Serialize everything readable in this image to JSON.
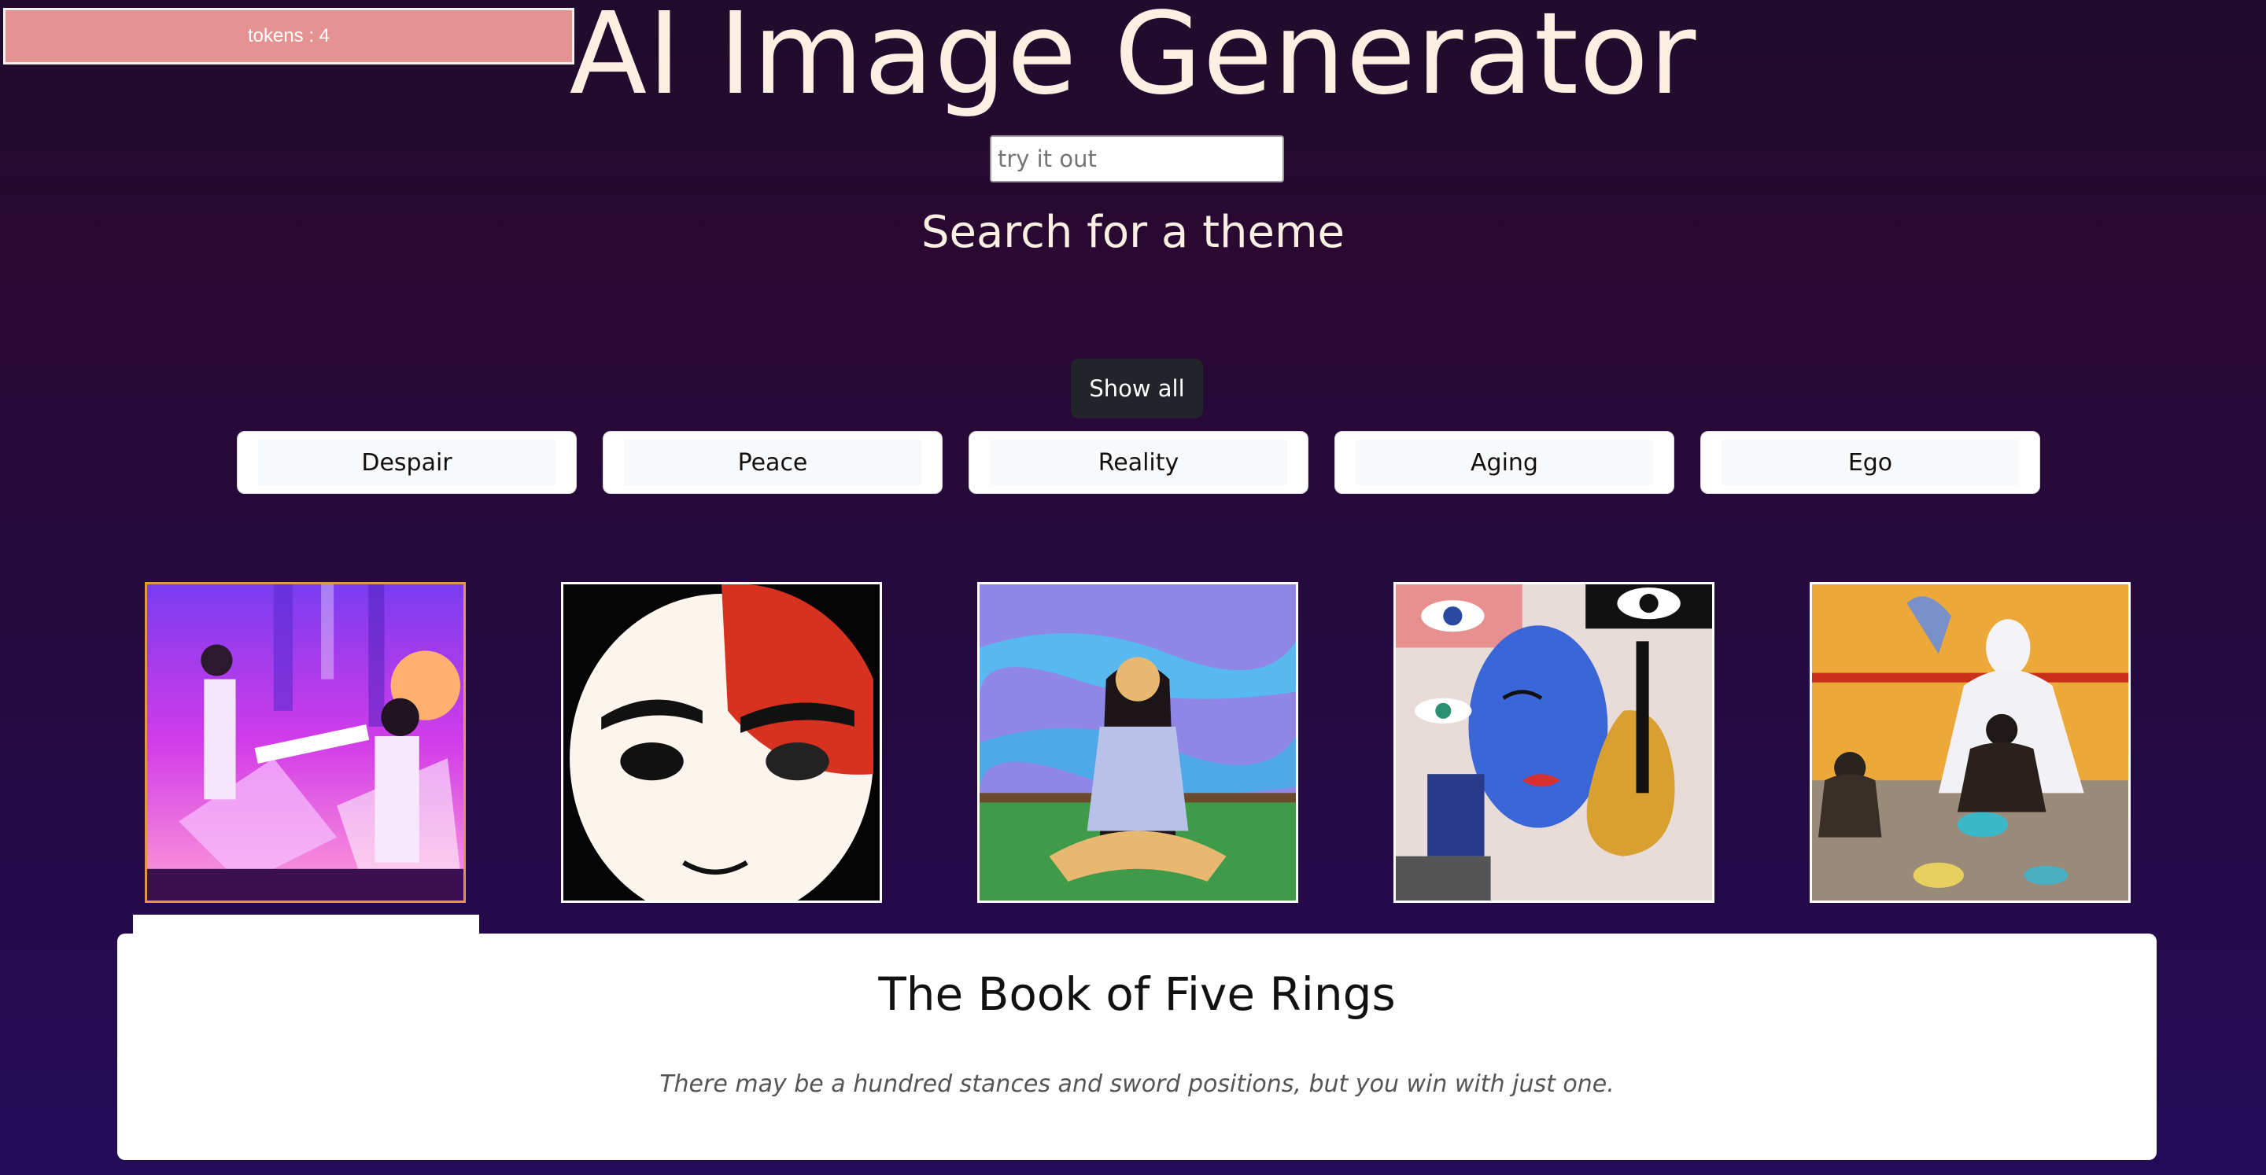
{
  "tokens": {
    "label": "tokens : 4"
  },
  "header": {
    "title": "AI Image Generator"
  },
  "search": {
    "placeholder": "try it out",
    "value": ""
  },
  "subtitle": "Search for a theme",
  "show_all_label": "Show all",
  "themes": [
    {
      "label": "Despair"
    },
    {
      "label": "Peace"
    },
    {
      "label": "Reality"
    },
    {
      "label": "Aging"
    },
    {
      "label": "Ego"
    }
  ],
  "gallery": {
    "selected_index": 0,
    "images": [
      {
        "subject": "samurai-vaporwave-art"
      },
      {
        "subject": "half-red-mask-face-art"
      },
      {
        "subject": "meditating-woman-art"
      },
      {
        "subject": "cubist-blue-face-guitar-art"
      },
      {
        "subject": "meditating-buddha-monks-art"
      }
    ]
  },
  "quote": {
    "title": "The Book of Five Rings",
    "text": "There may be a hundred stances and sword positions, but you win with just one."
  },
  "colors": {
    "tokens_bg": "#e59292",
    "show_all_bg": "#212529",
    "title_text": "#fbf0e2",
    "selected_border": "#e3964c"
  }
}
